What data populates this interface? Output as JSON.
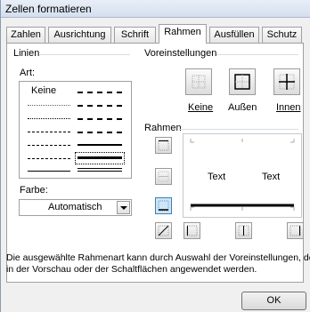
{
  "window": {
    "title": "Zellen formatieren"
  },
  "tabs": [
    {
      "label": "Zahlen"
    },
    {
      "label": "Ausrichtung"
    },
    {
      "label": "Schrift"
    },
    {
      "label": "Rahmen"
    },
    {
      "label": "Ausfüllen"
    },
    {
      "label": "Schutz"
    }
  ],
  "active_tab": "Rahmen",
  "linien": {
    "group_label": "Linien",
    "art_label": "Art:",
    "none_label": "Keine",
    "farbe_label": "Farbe:",
    "farbe_value": "Automatisch"
  },
  "voreinstellungen": {
    "group_label": "Voreinstellungen",
    "keine": "Keine",
    "aussen": "Außen",
    "innen": "Innen"
  },
  "rahmen": {
    "group_label": "Rahmen",
    "preview_text_1": "Text",
    "preview_text_2": "Text"
  },
  "info_text_1": "Die ausgewählte Rahmenart kann durch Auswahl der Voreinstellungen, de",
  "info_text_2": "in der Vorschau oder der Schaltflächen angewendet werden.",
  "ok_label": "OK"
}
